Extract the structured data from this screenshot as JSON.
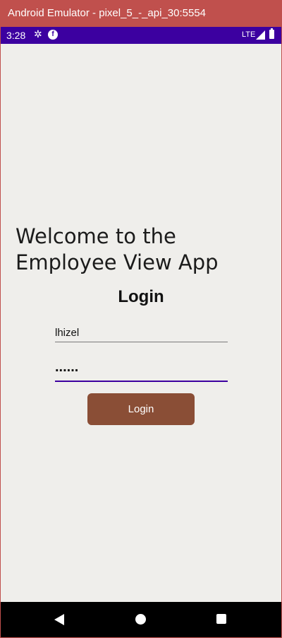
{
  "window": {
    "title": "Android Emulator - pixel_5_-_api_30:5554"
  },
  "status_bar": {
    "time": "3:28",
    "network": "LTE",
    "icons": [
      "settings-gear-icon",
      "notification-f-icon",
      "signal-icon",
      "battery-icon"
    ],
    "background_color": "#3c00a0"
  },
  "main": {
    "welcome_text": "Welcome to the Employee View App",
    "login_heading": "Login",
    "username": {
      "value": "lhizel"
    },
    "password": {
      "masked_value": "......"
    },
    "login_button_label": "Login",
    "button_color": "#8a4e36",
    "accent_color": "#3c00a0"
  },
  "nav_bar": {
    "icons": [
      "back-icon",
      "home-icon",
      "recents-icon"
    ]
  }
}
